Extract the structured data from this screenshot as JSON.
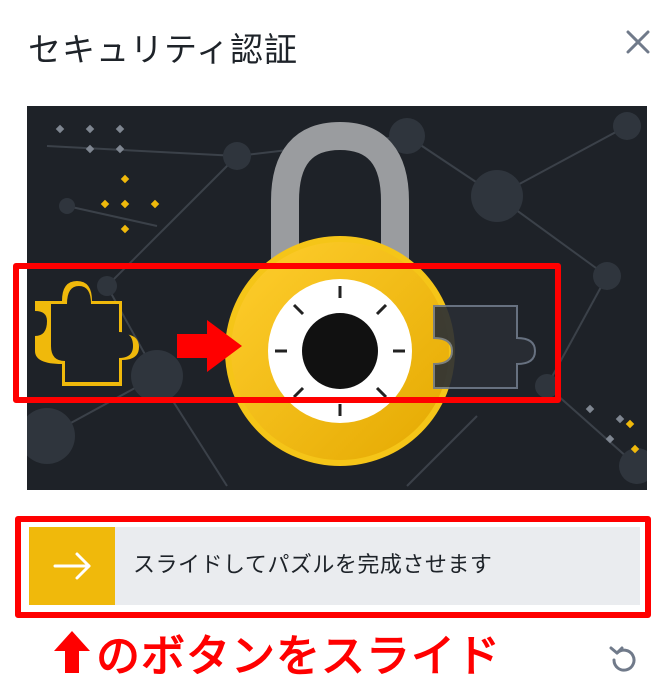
{
  "dialog": {
    "title": "セキュリティ認証",
    "close_icon": "close-icon",
    "refresh_icon": "refresh-icon"
  },
  "puzzle": {
    "image_description_icon": "padlock-icon",
    "piece_icon": "puzzle-piece-icon",
    "target_icon": "puzzle-slot-icon"
  },
  "slider": {
    "label": "スライドしてパズルを完成させます",
    "handle_icon": "arrow-right-icon"
  },
  "annotation": {
    "instruction": "のボタンをスライド",
    "arrow_up_icon": "arrow-up-icon"
  },
  "colors": {
    "accent": "#f0b90b",
    "annotation_red": "#ff0000",
    "background_dark": "#1e2228"
  }
}
